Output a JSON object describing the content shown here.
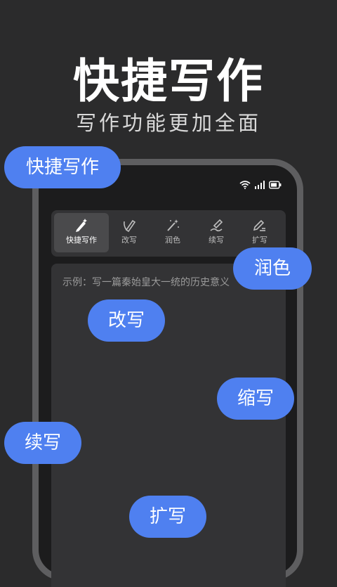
{
  "hero": {
    "title": "快捷写作",
    "subtitle": "写作功能更加全面"
  },
  "phone": {
    "toolbar": {
      "tabs": [
        {
          "label": "快捷写作",
          "icon": "pen-sparkle-icon",
          "active": true
        },
        {
          "label": "改写",
          "icon": "rewrite-pen-icon",
          "active": false
        },
        {
          "label": "润色",
          "icon": "magic-wand-icon",
          "active": false
        },
        {
          "label": "续写",
          "icon": "continue-pen-icon",
          "active": false
        },
        {
          "label": "扩写",
          "icon": "expand-pen-icon",
          "active": false
        }
      ]
    },
    "input": {
      "placeholder": "示例：写一篇秦始皇大一统的历史意义"
    }
  },
  "bubbles": {
    "quick_writing": "快捷写作",
    "polish": "润色",
    "rewrite": "改写",
    "shorten": "缩写",
    "continue": "续写",
    "expand": "扩写"
  },
  "colors": {
    "background": "#2b2b2c",
    "bubble": "#4f80f0",
    "panel": "#333335",
    "phone_frame": "#5e5e60"
  }
}
